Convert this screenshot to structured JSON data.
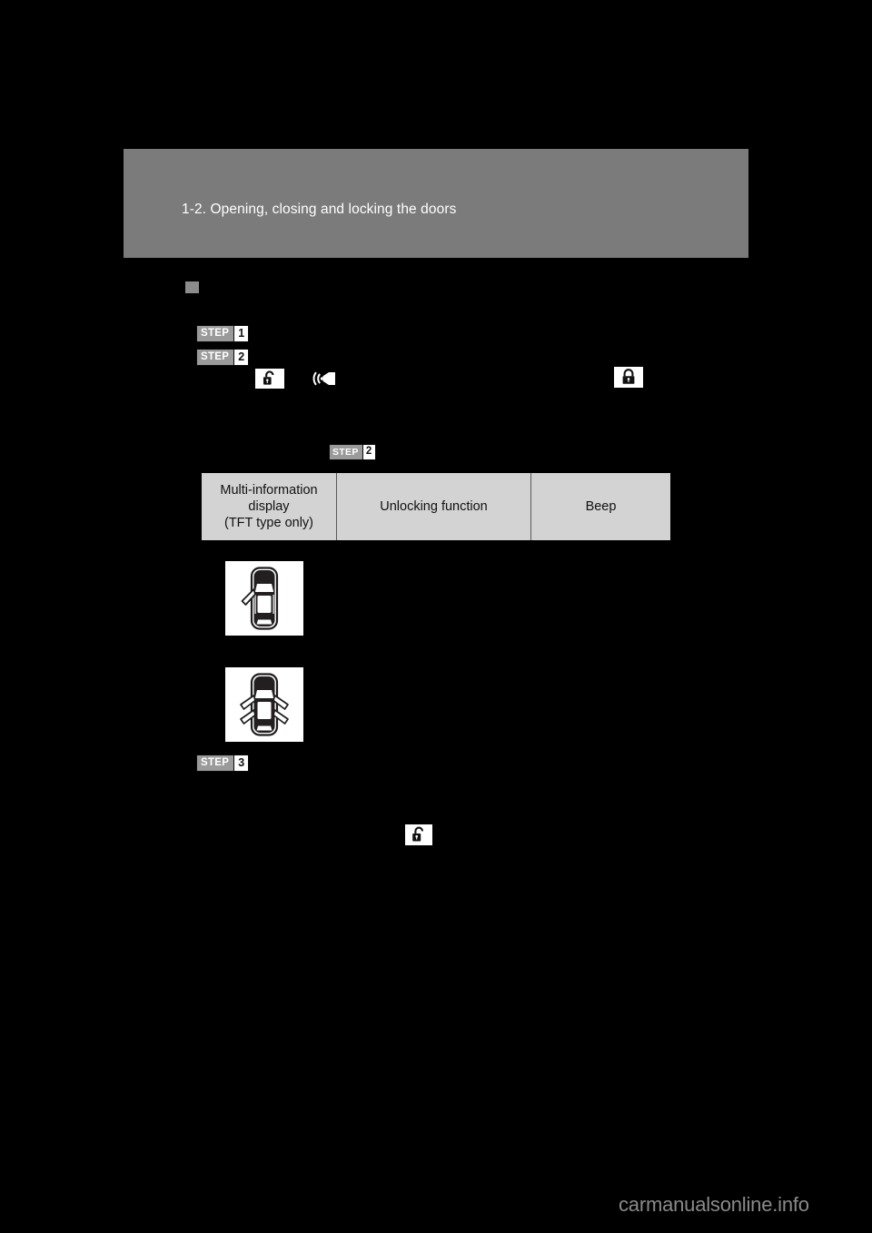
{
  "page": {
    "background_color": "#000000",
    "header": {
      "band_color": "#7b7b7b",
      "title": "1-2. Opening, closing and locking the doors"
    },
    "watermark": "carmanualsonline.info"
  },
  "section": {
    "bullet_color": "#8c8c8c"
  },
  "steps": [
    {
      "word": "STEP",
      "number": "1"
    },
    {
      "word": "STEP",
      "number": "2"
    },
    {
      "word": "STEP",
      "number": "2"
    },
    {
      "word": "STEP",
      "number": "3"
    }
  ],
  "pictograms": {
    "unlock_top": "unlock-icon",
    "beep": "beep-speaker-icon",
    "lock_right": "lock-icon",
    "unlock_bottom": "unlock-icon"
  },
  "table": {
    "headers": [
      "Multi-information\ndisplay\n(TFT type only)",
      "Unlocking function",
      "Beep"
    ],
    "header_line1": "Multi-information",
    "header_line2": "display",
    "header_line3": "(TFT type only)",
    "header_col2": "Unlocking function",
    "header_col3": "Beep",
    "header_bg": "#d3d3d3",
    "border_color": "#000000"
  },
  "figures": [
    {
      "name": "car-driver-door-highlighted",
      "doors_highlighted": 1
    },
    {
      "name": "car-all-doors-highlighted",
      "doors_highlighted": 4
    }
  ]
}
